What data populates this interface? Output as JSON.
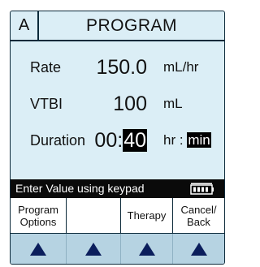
{
  "header": {
    "channel": "A",
    "title": "PROGRAM"
  },
  "params": {
    "rate": {
      "label": "Rate",
      "value": "150.0",
      "unit": "mL/hr"
    },
    "vtbi": {
      "label": "VTBI",
      "value": "100",
      "unit": "mL"
    },
    "duration": {
      "label": "Duration",
      "hours": "00",
      "separator": ":",
      "minutes": "40",
      "unit_hr": "hr",
      "unit_sep": ":",
      "unit_min": "min"
    }
  },
  "status": {
    "message": "Enter Value using keypad",
    "battery_icon": "battery-icon"
  },
  "softkeys": [
    {
      "label_line1": "Program",
      "label_line2": "Options"
    },
    {
      "label_line1": "",
      "label_line2": ""
    },
    {
      "label_line1": "Therapy",
      "label_line2": ""
    },
    {
      "label_line1": "Cancel/",
      "label_line2": "Back"
    }
  ],
  "arrow_icon": "up-triangle-icon",
  "colors": {
    "screen_bg": "#dbeef6",
    "arrow_row_bg": "#b6d3e2",
    "status_bg": "#0a0a0a",
    "highlight_bg": "#000000",
    "highlight_fg": "#ffffff"
  }
}
